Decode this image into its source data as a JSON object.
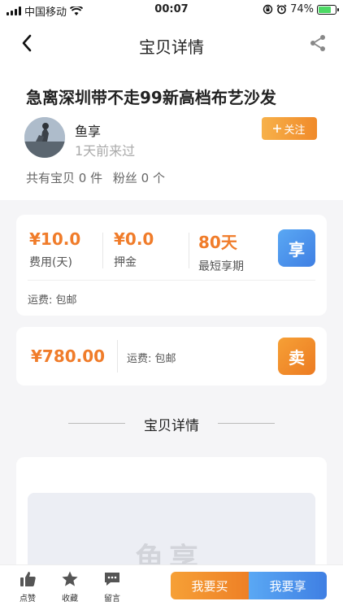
{
  "status_bar": {
    "carrier": "中国移动",
    "time": "00:07",
    "battery_text": "74%",
    "battery_level": 0.74,
    "icons": [
      "signal-icon",
      "wifi-icon",
      "orientation-lock-icon",
      "alarm-icon",
      "battery-icon"
    ]
  },
  "nav": {
    "title": "宝贝详情",
    "icons": [
      "back-icon",
      "share-icon"
    ]
  },
  "item": {
    "title": "急离深圳带不走99新高档布艺沙发"
  },
  "seller": {
    "name": "鱼享",
    "last_seen": "1天前来过",
    "follow_label": "关注",
    "follow_icon": "plus-icon"
  },
  "stats": {
    "items": "共有宝贝 0 件",
    "fans": "粉丝 0 个"
  },
  "rent": {
    "fee": "¥10.0",
    "fee_label": "费用(天)",
    "deposit": "¥0.0",
    "deposit_label": "押金",
    "min_period": "80天",
    "min_period_label": "最短享期",
    "shipping_label": "运费:",
    "shipping_value": "包邮",
    "action": "享"
  },
  "sell": {
    "price": "¥780.00",
    "shipping_label": "运费:",
    "shipping_value": "包邮",
    "action": "卖"
  },
  "detail": {
    "section_title": "宝贝详情",
    "watermark": "鱼享"
  },
  "bottom": {
    "like_label": "点赞",
    "favorite_label": "收藏",
    "comment_label": "留言",
    "buy_label": "我要买",
    "rent_label": "我要享",
    "icons": [
      "thumb-up-icon",
      "star-icon",
      "comment-icon"
    ]
  },
  "colors": {
    "accent_orange": "#f07c2a",
    "accent_blue": "#3f7fe3",
    "battery_green": "#4cd964"
  }
}
